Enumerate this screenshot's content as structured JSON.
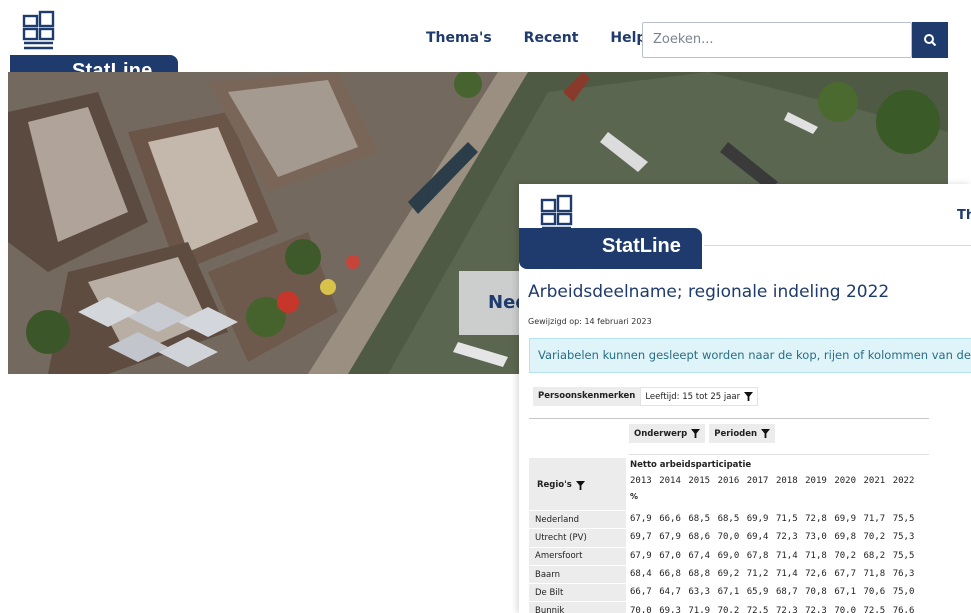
{
  "back": {
    "brand": "StatLine",
    "nav": [
      "Thema's",
      "Recent",
      "Help"
    ],
    "search_placeholder": "Zoeken...",
    "hero_card_text": "Ned"
  },
  "front": {
    "brand": "StatLine",
    "nav_cut": "Th",
    "title": "Arbeidsdeelname; regionale indeling 2022",
    "modified": "Gewijzigd op: 14 februari 2023",
    "info": "Variabelen kunnen gesleept worden naar de kop, rijen of kolommen van de tabel. In d",
    "filter": {
      "label": "Persoonskenmerken",
      "value": "Leeftijd: 15 tot 25 jaar"
    },
    "column_pills": [
      "Onderwerp",
      "Perioden"
    ],
    "row_pill": "Regio's",
    "subject": "Netto arbeidsparticipatie",
    "unit": "%",
    "years": [
      "2013",
      "2014",
      "2015",
      "2016",
      "2017",
      "2018",
      "2019",
      "2020",
      "2021",
      "2022"
    ],
    "rows": [
      {
        "name": "Nederland",
        "values": [
          "67,9",
          "66,6",
          "68,5",
          "68,5",
          "69,9",
          "71,5",
          "72,8",
          "69,9",
          "71,7",
          "75,5"
        ]
      },
      {
        "name": "Utrecht (PV)",
        "values": [
          "69,7",
          "67,9",
          "68,6",
          "70,0",
          "69,4",
          "72,3",
          "73,0",
          "69,8",
          "70,2",
          "75,3"
        ]
      },
      {
        "name": "Amersfoort",
        "values": [
          "67,9",
          "67,0",
          "67,4",
          "69,0",
          "67,8",
          "71,4",
          "71,8",
          "70,2",
          "68,2",
          "75,5"
        ]
      },
      {
        "name": "Baarn",
        "values": [
          "68,4",
          "66,8",
          "68,8",
          "69,2",
          "71,2",
          "71,4",
          "72,6",
          "67,7",
          "71,8",
          "76,3"
        ]
      },
      {
        "name": "De Bilt",
        "values": [
          "66,7",
          "64,7",
          "63,3",
          "67,1",
          "65,9",
          "68,7",
          "70,8",
          "67,1",
          "70,6",
          "75,0"
        ]
      },
      {
        "name": "Bunnik",
        "values": [
          "70,0",
          "69,3",
          "71,9",
          "70,2",
          "72,5",
          "72,3",
          "72,3",
          "70,0",
          "72,5",
          "76,6"
        ]
      }
    ]
  },
  "colors": {
    "brand_blue": "#1f3a6d",
    "info_bg": "#dff4f8",
    "info_text": "#2a6d86"
  }
}
